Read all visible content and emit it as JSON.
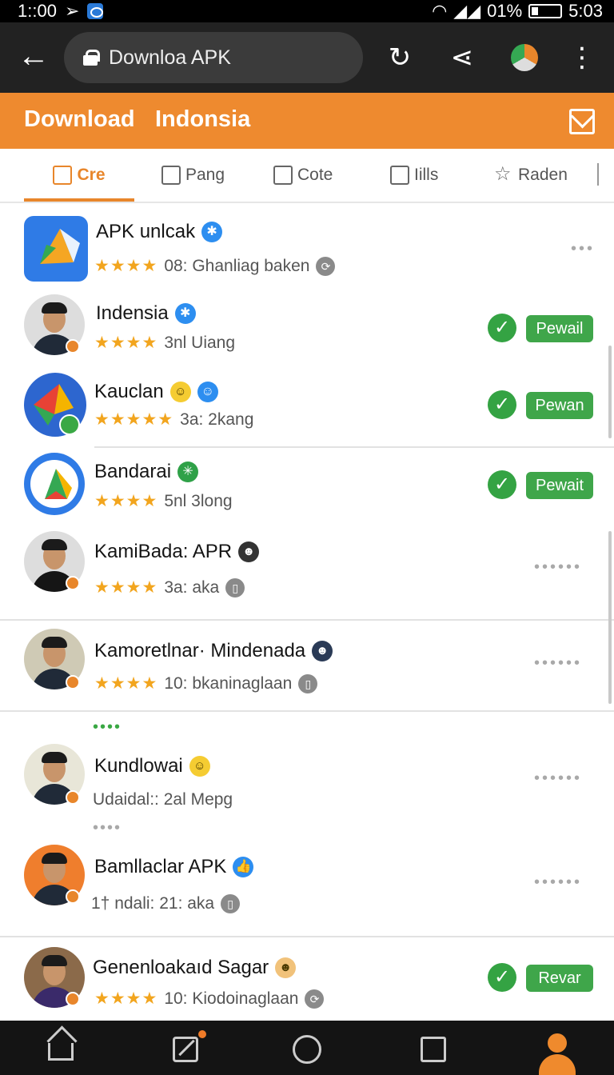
{
  "status": {
    "time_left": "1::00",
    "battery": "01%",
    "time_right": "5:03"
  },
  "browser": {
    "url_text": "Downloa APK"
  },
  "header": {
    "title_left": "Download",
    "title_right": "Indonsia"
  },
  "tabs": [
    {
      "label": "Cre",
      "icon": "hammer-icon",
      "active": true
    },
    {
      "label": "Pang",
      "icon": "pen-icon"
    },
    {
      "label": "Cote",
      "icon": "card-icon"
    },
    {
      "label": "Iills",
      "icon": "clipboard-icon"
    },
    {
      "label": "Raden",
      "icon": "star-icon"
    }
  ],
  "items": [
    {
      "name": "APK unlcak",
      "rating": "★★★★",
      "meta": "08: Ghanliag baken",
      "action": "more"
    },
    {
      "name": "Indensia",
      "rating": "★★★★",
      "meta": "3nl Uiang",
      "action": "install",
      "button": "Pewail"
    },
    {
      "name": "Kauclan",
      "rating": "★★★★★",
      "meta": "3a: 2kang",
      "action": "install",
      "button": "Pewan"
    },
    {
      "name": "Bandarai",
      "rating": "★★★★",
      "meta": "5nl 3long",
      "action": "install",
      "button": "Pewait"
    },
    {
      "name": "KamiBada: APR",
      "rating": "★★★★",
      "meta": "3a: aka",
      "action": "more"
    },
    {
      "name": "Kamoretlnar· Mindenada",
      "rating": "★★★★",
      "meta": "10: bkaninaglaan",
      "action": "more"
    },
    {
      "name": "Kundlowai",
      "rating": "",
      "meta": "Udaidal:: 2al Mepg",
      "action": "more"
    },
    {
      "name": "Bamllaclar APK",
      "rating": "",
      "meta": "1† ndali: 21: aka",
      "action": "more"
    },
    {
      "name": "Genenloakaıd Sagar",
      "rating": "★★★★",
      "meta": "10: Kiodoinaglaan",
      "action": "install",
      "button": "Revar"
    }
  ],
  "colors": {
    "accent": "#ee8a2f",
    "green": "#3fa64a",
    "verified": "#2d8ef0"
  }
}
